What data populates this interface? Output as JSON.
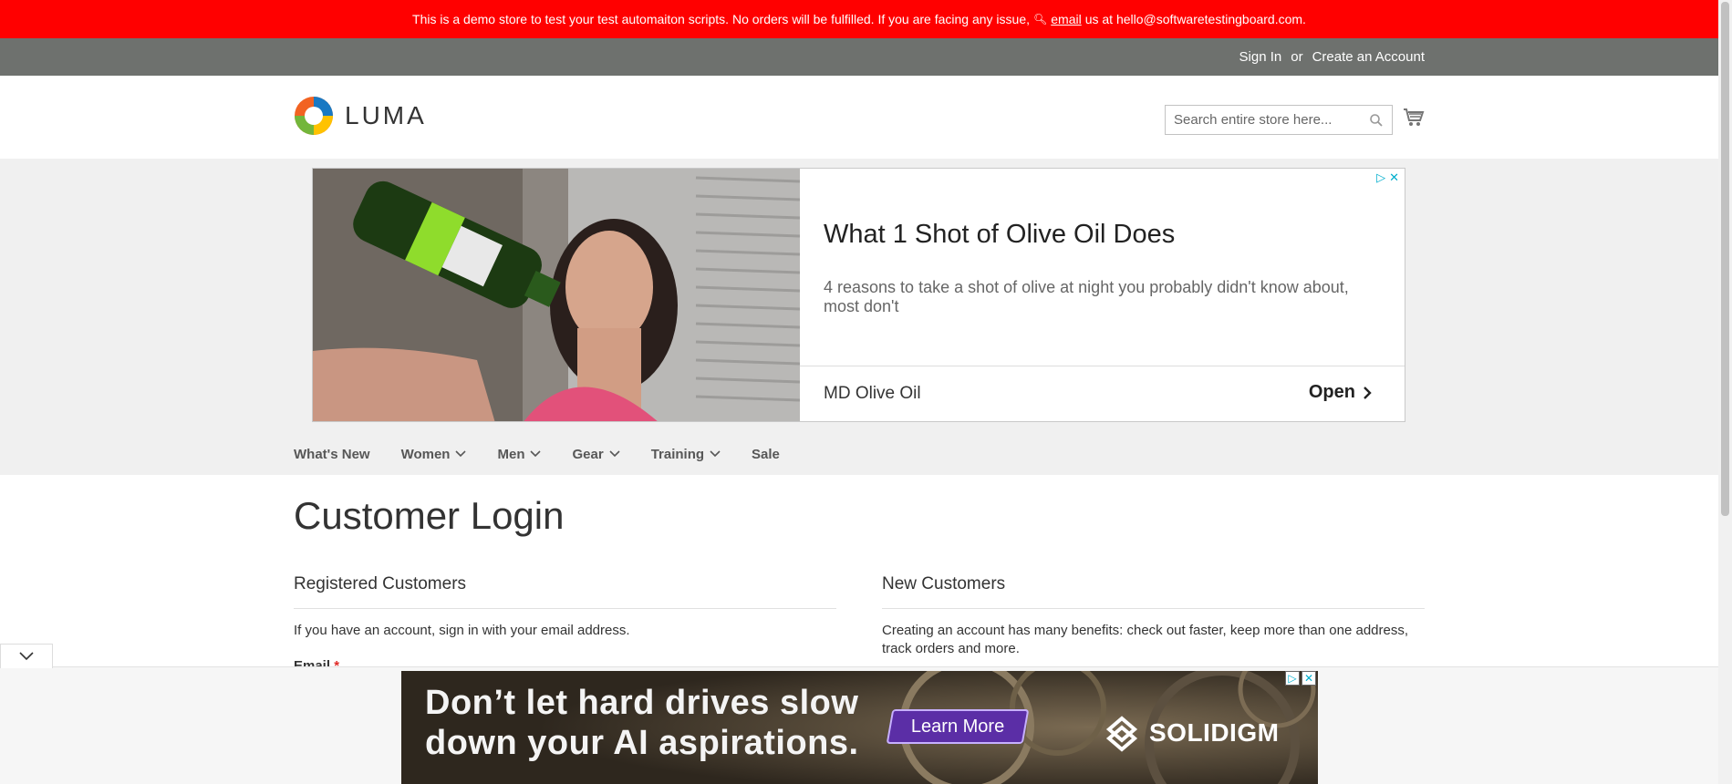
{
  "demo_notice": {
    "text_before": "This is a demo store to test your test automaiton scripts. No orders will be fulfilled. If you are facing any issue,",
    "email_link": "email",
    "text_after": "us at hello@softwaretestingboard.com."
  },
  "top_links": {
    "sign_in": "Sign In",
    "or": "or",
    "create_account": "Create an Account"
  },
  "header": {
    "logo_text": "LUMA",
    "search_placeholder": "Search entire store here..."
  },
  "ad_top": {
    "headline": "What 1 Shot of Olive Oil Does",
    "description": "4 reasons to take a shot of olive at night you probably didn't know about, most don't",
    "advertiser": "MD Olive Oil",
    "cta": "Open",
    "accent": "#00aecd"
  },
  "nav": {
    "items": [
      {
        "label": "What's New",
        "has_menu": false
      },
      {
        "label": "Women",
        "has_menu": true
      },
      {
        "label": "Men",
        "has_menu": true
      },
      {
        "label": "Gear",
        "has_menu": true
      },
      {
        "label": "Training",
        "has_menu": true
      },
      {
        "label": "Sale",
        "has_menu": false
      }
    ]
  },
  "page": {
    "title": "Customer Login",
    "registered": {
      "title": "Registered Customers",
      "text": "If you have an account, sign in with your email address.",
      "email_label": "Email",
      "required_mark": "*"
    },
    "new_customers": {
      "title": "New Customers",
      "text": "Creating an account has many benefits: check out faster, keep more than one address, track orders and more."
    }
  },
  "ad_bottom": {
    "line1": "Don’t let hard drives slow",
    "line2": "down your AI aspirations.",
    "cta": "Learn More",
    "brand": "SOLIDIGM"
  },
  "colors": {
    "demo_bar": "#ff0000",
    "top_links_bar": "#6e716e",
    "page_band": "#f0f0f0"
  }
}
